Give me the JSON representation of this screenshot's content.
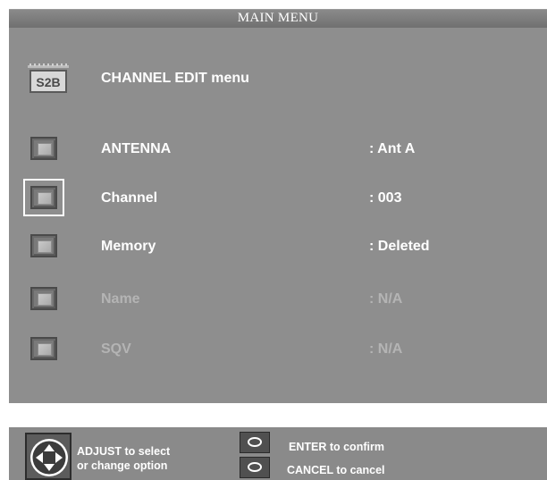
{
  "title": "MAIN MENU",
  "header": {
    "icon": "s2b-edit-icon",
    "icon_text": "S2B",
    "label": "CHANNEL EDIT menu"
  },
  "rows": [
    {
      "label": "ANTENNA",
      "value": ": Ant A",
      "state": "enabled"
    },
    {
      "label": "Channel",
      "value": ": 003",
      "state": "enabled",
      "selected": true
    },
    {
      "label": "Memory",
      "value": ": Deleted",
      "state": "enabled"
    },
    {
      "label": "Name",
      "value": ": N/A",
      "state": "disabled"
    },
    {
      "label": "SQV",
      "value": ": N/A",
      "state": "disabled"
    }
  ],
  "help": {
    "adjust_line1": "ADJUST to select",
    "adjust_line2": "or  change  option",
    "enter": "ENTER to confirm",
    "cancel": "CANCEL to cancel",
    "nav_icon": "directional-pad-icon",
    "enter_icon": "oval-button-icon",
    "cancel_icon": "oval-button-icon"
  },
  "colors": {
    "panel": "#8e8e8e",
    "title_bar": "#7a7a7a",
    "text_active": "#ffffff",
    "text_disabled": "#b4b4b4",
    "selection_border": "#ffffff"
  }
}
